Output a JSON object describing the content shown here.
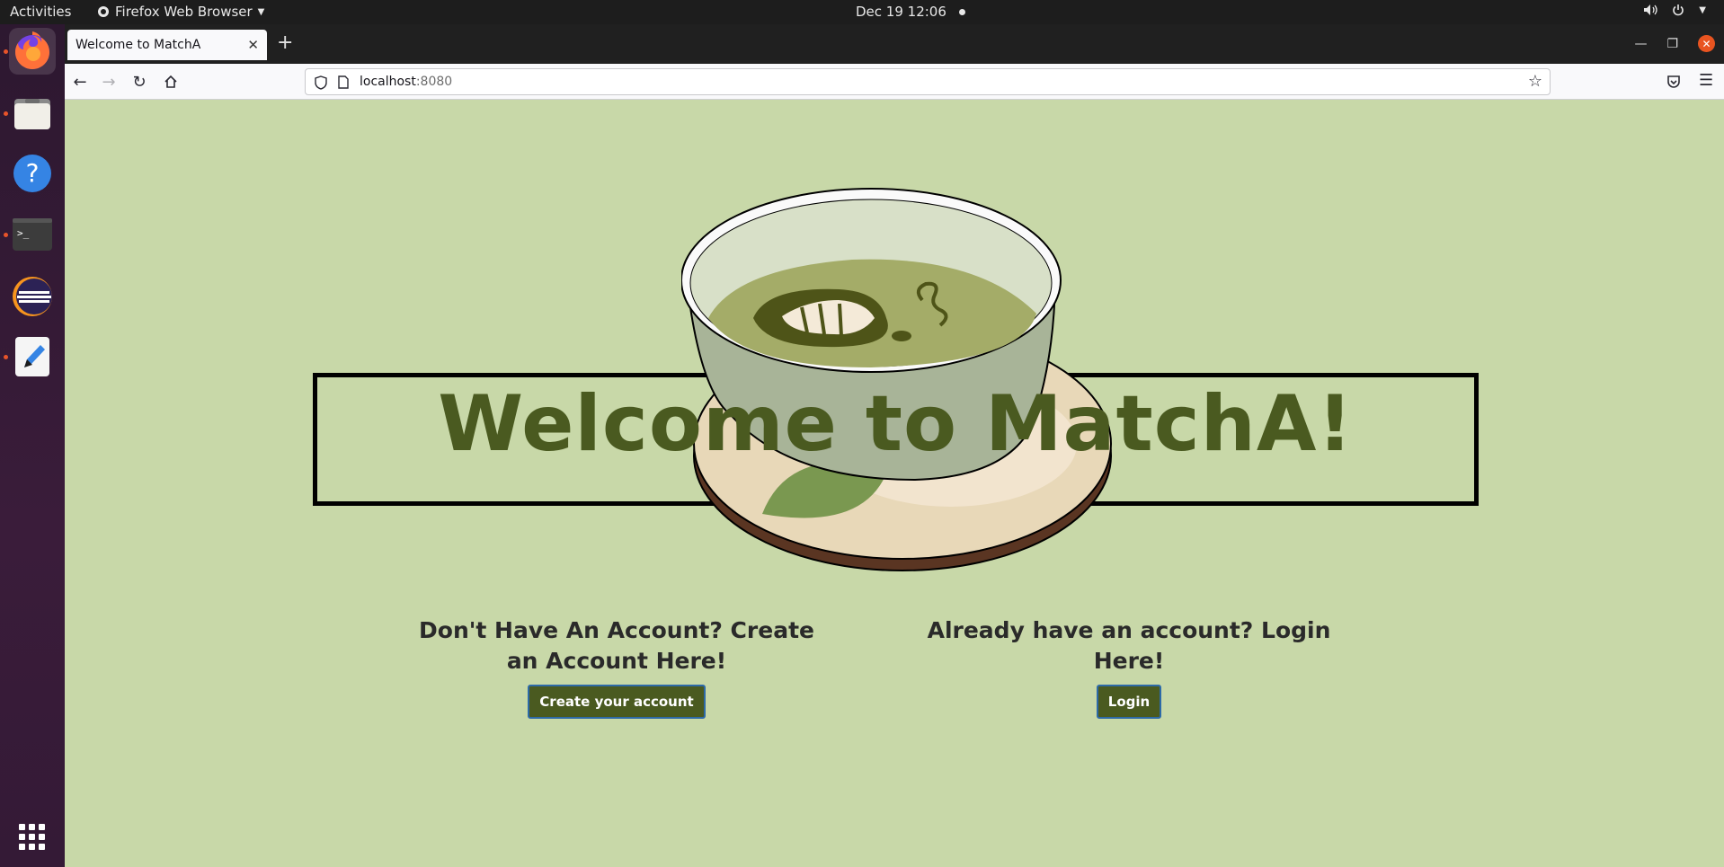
{
  "topbar": {
    "activities": "Activities",
    "app_name": "Firefox Web Browser",
    "clock": "Dec 19  12:06"
  },
  "dock": {
    "items": [
      "firefox-icon",
      "files-icon",
      "help-icon",
      "terminal-icon",
      "eclipse-icon",
      "text-editor-icon"
    ],
    "apps_grid": "show-apps-icon"
  },
  "browser": {
    "tab_title": "Welcome to MatchA",
    "url_host": "localhost",
    "url_port": ":8080"
  },
  "page": {
    "title": "Welcome to MatchA!",
    "signup": {
      "heading": "Don't Have An Account? Create an Account Here!",
      "button": "Create your account"
    },
    "login": {
      "heading": "Already have an account? Login Here!",
      "button": "Login"
    }
  },
  "colors": {
    "page_bg": "#c8d8a8",
    "brand_green": "#4a5a20",
    "button_border": "#2d6aa8"
  }
}
